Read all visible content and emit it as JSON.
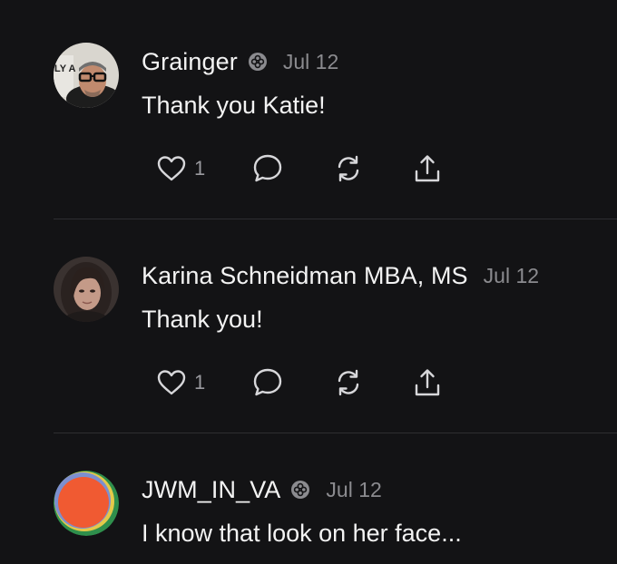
{
  "comments": [
    {
      "author": "Grainger",
      "verified": true,
      "date": "Jul 12",
      "text": "Thank you Katie!",
      "likes": "1",
      "avatar": "man-with-glasses-avatar",
      "avatar_sign_text": "LY A"
    },
    {
      "author": "Karina Schneidman MBA, MS",
      "verified": false,
      "date": "Jul 12",
      "text": "Thank you!",
      "likes": "1",
      "avatar": "woman-portrait-avatar"
    },
    {
      "author": "JWM_IN_VA",
      "verified": true,
      "date": "Jul 12",
      "text": "I know that look on her face...",
      "avatar": "orange-circle-avatar"
    }
  ],
  "icons": {
    "like": "heart-icon",
    "reply": "speech-bubble-icon",
    "restack": "restack-icon",
    "share": "share-icon",
    "verified": "verified-badge-icon"
  },
  "colors": {
    "background": "#131315",
    "text": "#f3f3f3",
    "muted": "#8b8b8f",
    "divider": "#2e2e31"
  }
}
